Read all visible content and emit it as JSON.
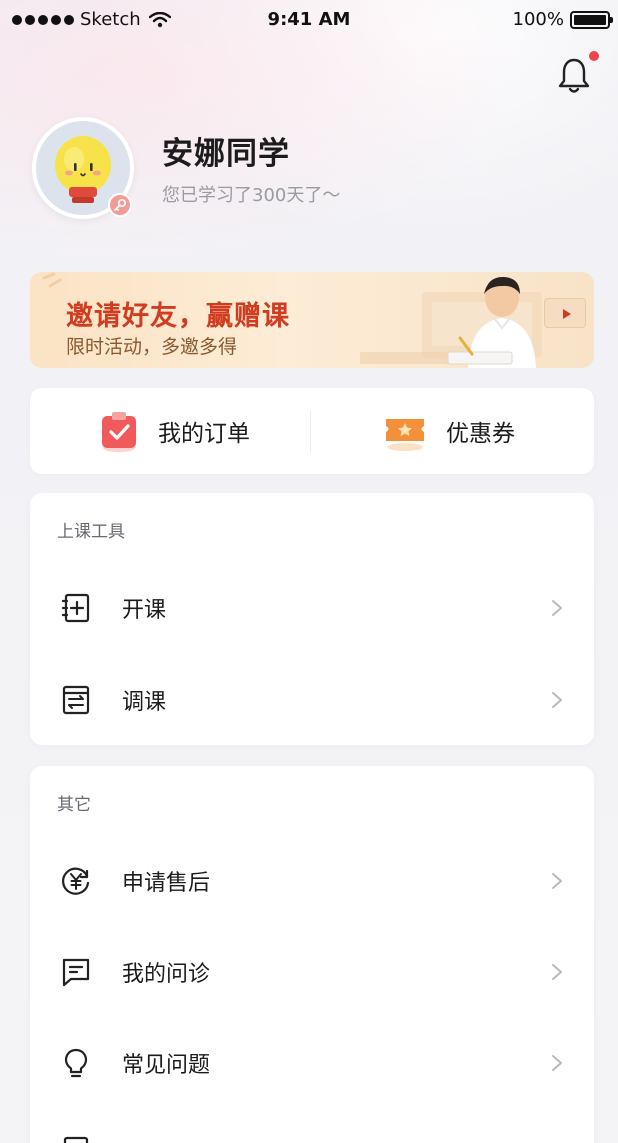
{
  "status_bar": {
    "carrier": "Sketch",
    "time": "9:41 AM",
    "battery": "100%"
  },
  "profile": {
    "name": "安娜同学",
    "subtitle": "您已学习了300天了～"
  },
  "banner": {
    "title": "邀请好友，赢赠课",
    "subtitle": "限时活动，多邀多得"
  },
  "quick_actions": [
    {
      "label": "我的订单",
      "icon": "order-clipboard-icon"
    },
    {
      "label": "优惠券",
      "icon": "coupon-icon"
    }
  ],
  "tools_section": {
    "title": "上课工具",
    "items": [
      {
        "label": "开课",
        "icon": "add-note-icon"
      },
      {
        "label": "调课",
        "icon": "swap-note-icon"
      }
    ]
  },
  "other_section": {
    "title": "其它",
    "items": [
      {
        "label": "申请售后",
        "icon": "yuan-refund-icon"
      },
      {
        "label": "我的问诊",
        "icon": "chat-note-icon"
      },
      {
        "label": "常见问题",
        "icon": "lightbulb-icon"
      }
    ]
  },
  "colors": {
    "accent_red": "#f0444d",
    "banner_red": "#d13b1f",
    "coupon_orange": "#f5903a"
  }
}
